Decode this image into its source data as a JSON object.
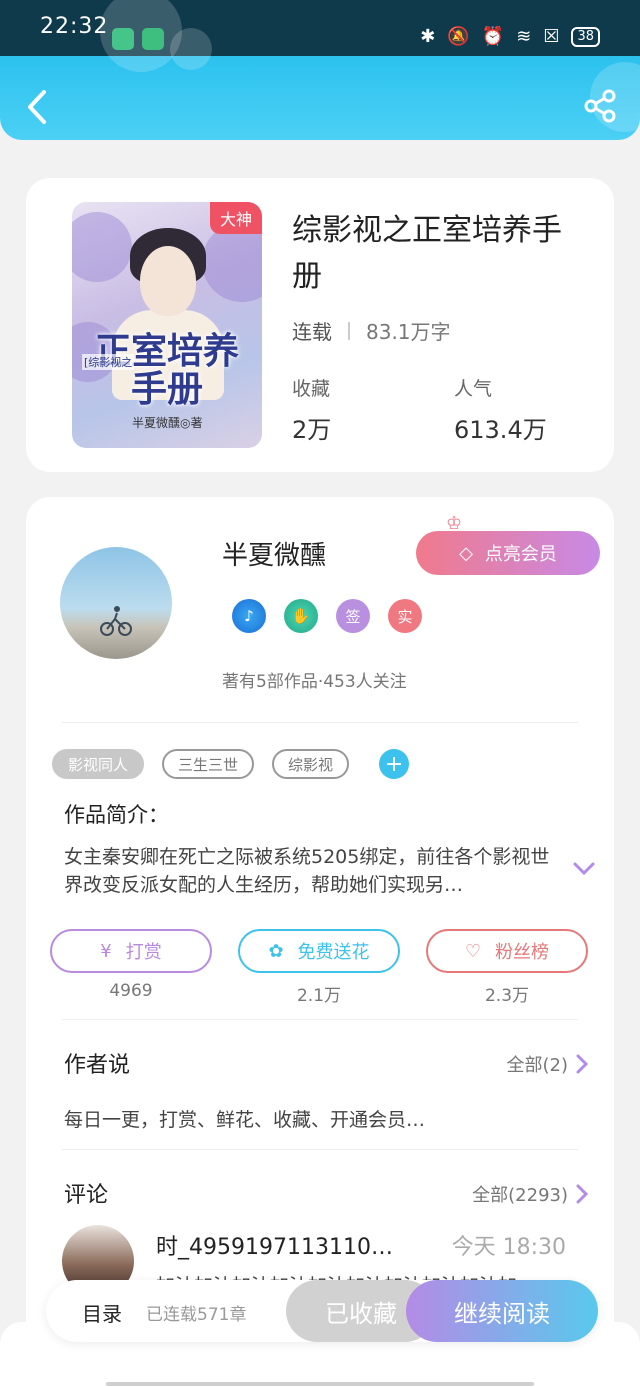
{
  "status_bar": {
    "time": "22:32",
    "battery": "38"
  },
  "colors": {
    "accent": "#2ec3ef",
    "vip": "#f07a8c",
    "reward": "#b88ae0",
    "flower": "#3dc2ee",
    "fans": "#e57878"
  },
  "book": {
    "badge": "大神",
    "title": "综影视之正室培养手册",
    "status": "连载",
    "word_count": "83.1万字",
    "stats": [
      {
        "label": "收藏",
        "value": "2万"
      },
      {
        "label": "人气",
        "value": "613.4万"
      }
    ],
    "cover": {
      "title": "正室培养手册",
      "series": "[综影视之",
      "author": "半夏微醺◎著"
    }
  },
  "author": {
    "name": "半夏微醺",
    "vip_button": "点亮会员",
    "badges": [
      "music-badge",
      "handshake-badge",
      "签",
      "实"
    ],
    "info": "著有5部作品·453人关注"
  },
  "tags": [
    "影视同人",
    "三生三世",
    "综影视"
  ],
  "intro": {
    "title": "作品简介：",
    "text": "女主秦安卿在死亡之际被系统5205绑定，前往各个影视世界改变反派女配的人生经历，帮助她们实现另…"
  },
  "actions": [
    {
      "label": "打赏",
      "count": "4969",
      "icon": "yuan-icon"
    },
    {
      "label": "免费送花",
      "count": "2.1万",
      "icon": "flower-icon"
    },
    {
      "label": "粉丝榜",
      "count": "2.3万",
      "icon": "fans-icon"
    }
  ],
  "author_says": {
    "title": "作者说",
    "more": "全部(2)",
    "text": "每日一更，打赏、鲜花、收藏、开通会员…"
  },
  "comments": {
    "title": "评论",
    "more": "全部(2293)",
    "first": {
      "user": "时_4959197113110…",
      "time": "今天 18:30",
      "text": "加油加油加油加油加油加油加油加油加油加"
    }
  },
  "bottom_bar": {
    "toc": "目录",
    "chapters": "已连载571章",
    "collected": "已收藏",
    "read": "继续阅读"
  }
}
